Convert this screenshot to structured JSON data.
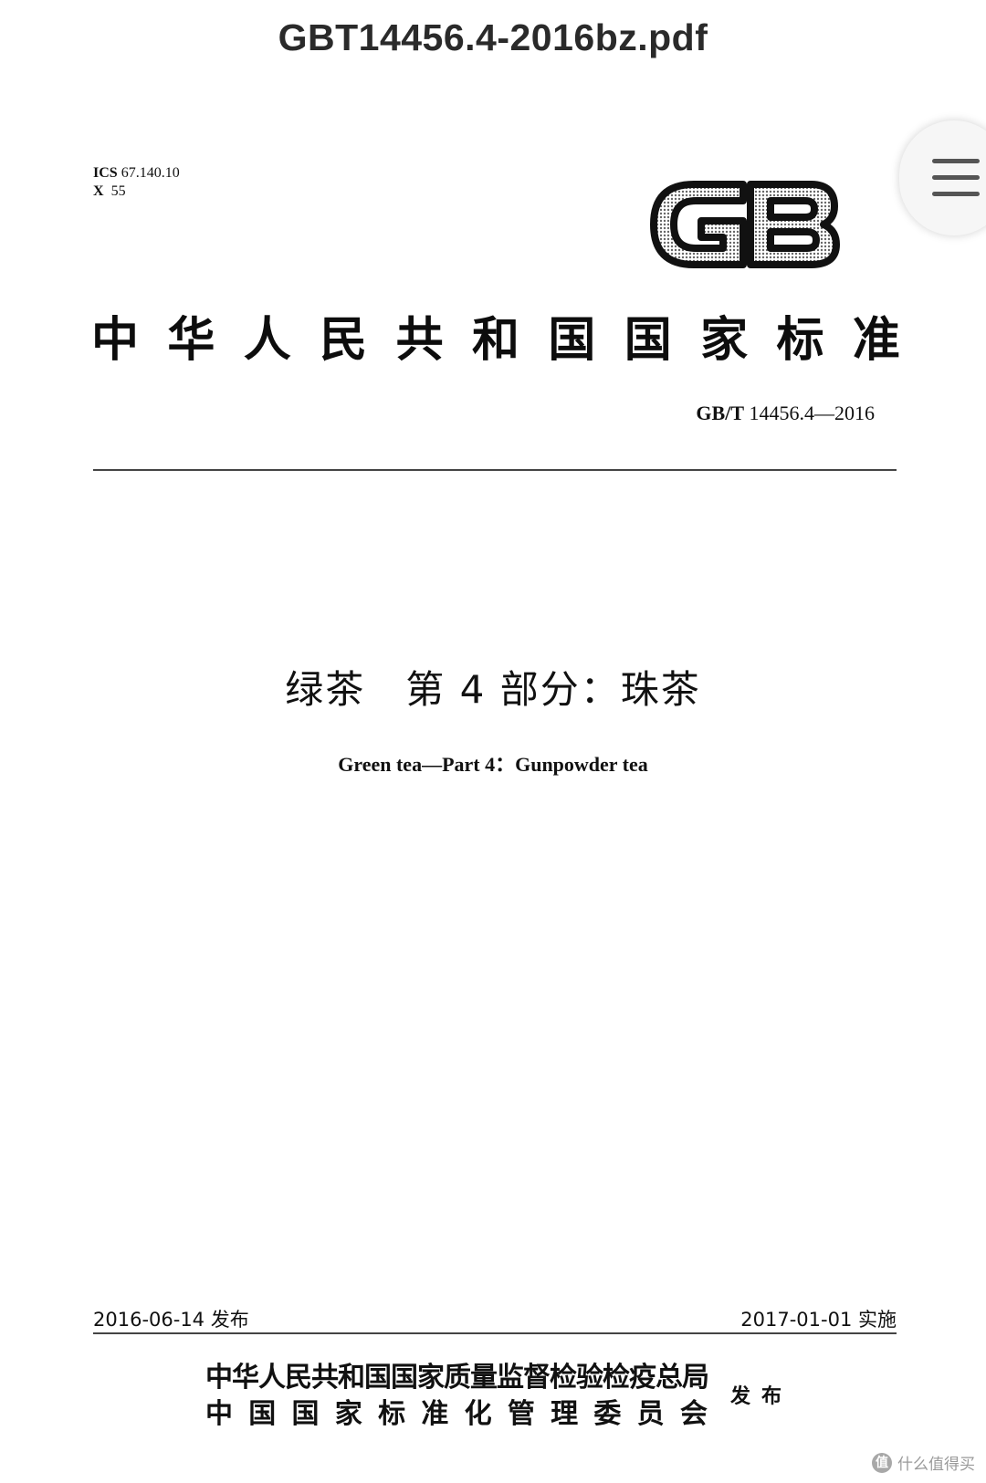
{
  "viewer": {
    "file_name": "GBT14456.4-2016bz.pdf"
  },
  "page": {
    "ics_label": "ICS",
    "ics_code": "67.140.10",
    "class_label": "X",
    "class_code": "55",
    "logo_text": "GB",
    "national_title_chars": [
      "中",
      "华",
      "人",
      "民",
      "共",
      "和",
      "国",
      "国",
      "家",
      "标",
      "准"
    ],
    "std_prefix": "GB/T",
    "std_number": "14456.4—2016",
    "cn_title": "绿茶　第 4 部分：珠茶",
    "en_title": "Green tea—Part 4：Gunpowder tea",
    "issue_date": "2016-06-14 发布",
    "impl_date": "2017-01-01 实施",
    "issuer_line1": "中华人民共和国国家质量监督检验检疫总局",
    "issuer_line2_chars": [
      "中",
      "国",
      "国",
      "家",
      "标",
      "准",
      "化",
      "管",
      "理",
      "委",
      "员",
      "会"
    ],
    "publish_word": "发布"
  },
  "watermark": {
    "icon_text": "值",
    "text": "什么值得买"
  },
  "icons": {
    "menu": "menu-icon",
    "logo": "gb-logo"
  }
}
